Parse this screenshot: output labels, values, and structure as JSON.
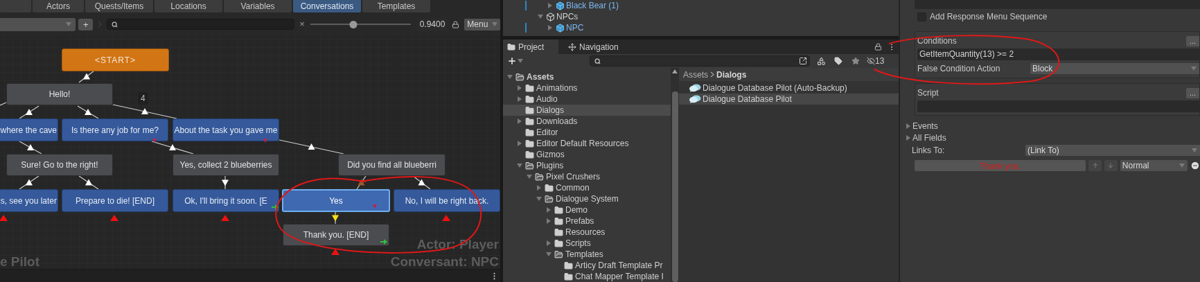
{
  "conversation_editor": {
    "tabs": [
      {
        "label": "Actors",
        "selected": false
      },
      {
        "label": "Quests/Items",
        "selected": false
      },
      {
        "label": "Locations",
        "selected": false
      },
      {
        "label": "Variables",
        "selected": false
      },
      {
        "label": "Conversations",
        "selected": true
      },
      {
        "label": "Templates",
        "selected": false
      }
    ],
    "toolbar": {
      "add_button": "+",
      "clear_search": "×",
      "zoom": {
        "level": 0.43,
        "value": "0.9400"
      },
      "menu_button": "Menu"
    },
    "nodes": [
      {
        "text": "<START>",
        "kind": "start",
        "selected": false
      },
      {
        "text": "Hello!",
        "kind": "npc",
        "selected": false
      },
      {
        "text": "where the cave",
        "kind": "player",
        "selected": false
      },
      {
        "text": "Is there any job for me?",
        "kind": "player",
        "selected": false
      },
      {
        "text": "About the task you gave me",
        "kind": "player",
        "selected": false
      },
      {
        "text": "Sure! Go to the right!",
        "kind": "npc",
        "selected": false
      },
      {
        "text": "Yes, collect 2 blueberries",
        "kind": "npc",
        "selected": false
      },
      {
        "text": "Did you find all blueberri",
        "kind": "npc",
        "selected": false
      },
      {
        "text": "s, see you later",
        "kind": "player",
        "selected": false
      },
      {
        "text": "Prepare to die! [END]",
        "kind": "player",
        "selected": false
      },
      {
        "text": "Ok, I'll bring it soon. [E",
        "kind": "player",
        "selected": false
      },
      {
        "text": "Yes",
        "kind": "player",
        "selected": true
      },
      {
        "text": "No, I will be right back.",
        "kind": "player",
        "selected": false
      },
      {
        "text": "Thank you. [END]",
        "kind": "npc",
        "selected": false
      }
    ],
    "link_count": "4",
    "canvas_labels": {
      "database": "e Pilot",
      "actor": "Actor: Player",
      "conversant": "Conversant: NPC"
    }
  },
  "hierarchy": {
    "cut_parent_children": [
      {
        "name": "Black Bear (1)",
        "kind": "prefab",
        "expanded": false
      }
    ],
    "items": [
      {
        "name": "NPCs",
        "kind": "object",
        "expanded": true,
        "children": [
          {
            "name": "NPC",
            "kind": "prefab",
            "expanded": false
          }
        ]
      }
    ]
  },
  "project": {
    "tabs": [
      {
        "label": "Project",
        "selected": true
      },
      {
        "label": "Navigation",
        "selected": false
      }
    ],
    "hidden_count": "13",
    "tree": [
      {
        "name": "Assets",
        "has_children": true,
        "expanded": true,
        "selected": false,
        "children": [
          {
            "name": "Animations",
            "has_children": true,
            "expanded": false,
            "selected": false
          },
          {
            "name": "Audio",
            "has_children": true,
            "expanded": false,
            "selected": false
          },
          {
            "name": "Dialogs",
            "has_children": false,
            "expanded": false,
            "selected": true
          },
          {
            "name": "Downloads",
            "has_children": true,
            "expanded": false,
            "selected": false
          },
          {
            "name": "Editor",
            "has_children": false,
            "expanded": false,
            "selected": false
          },
          {
            "name": "Editor Default Resources",
            "has_children": true,
            "expanded": false,
            "selected": false
          },
          {
            "name": "Gizmos",
            "has_children": false,
            "expanded": false,
            "selected": false
          },
          {
            "name": "Plugins",
            "has_children": true,
            "expanded": true,
            "selected": false,
            "children": [
              {
                "name": "Pixel Crushers",
                "has_children": true,
                "expanded": true,
                "selected": false,
                "children": [
                  {
                    "name": "Common",
                    "has_children": true,
                    "expanded": false,
                    "selected": false
                  },
                  {
                    "name": "Dialogue System",
                    "has_children": true,
                    "expanded": true,
                    "selected": false,
                    "children": [
                      {
                        "name": "Demo",
                        "has_children": true,
                        "expanded": false,
                        "selected": false
                      },
                      {
                        "name": "Prefabs",
                        "has_children": true,
                        "expanded": false,
                        "selected": false
                      },
                      {
                        "name": "Resources",
                        "has_children": false,
                        "expanded": false,
                        "selected": false
                      },
                      {
                        "name": "Scripts",
                        "has_children": true,
                        "expanded": false,
                        "selected": false
                      },
                      {
                        "name": "Templates",
                        "has_children": true,
                        "expanded": true,
                        "selected": false,
                        "children": [
                          {
                            "name": "Articy Draft Template Pr",
                            "has_children": false,
                            "expanded": false,
                            "selected": false
                          },
                          {
                            "name": "Chat Mapper Template I",
                            "has_children": false,
                            "expanded": false,
                            "selected": false
                          }
                        ]
                      }
                    ]
                  }
                ]
              }
            ]
          }
        ]
      }
    ],
    "breadcrumb": [
      "Assets",
      "Dialogs"
    ],
    "files": [
      {
        "name": "Dialogue Database Pilot (Auto-Backup)",
        "selected": false
      },
      {
        "name": "Dialogue Database Pilot",
        "selected": true
      }
    ]
  },
  "inspector": {
    "add_response_menu_sequence": {
      "label": "Add Response Menu Sequence",
      "checked": false
    },
    "conditions": {
      "label": "Conditions",
      "more_button": "...",
      "value": "GetItemQuantity(13) >= 2",
      "false_action_label": "False Condition Action",
      "false_action": "Block"
    },
    "script": {
      "label": "Script",
      "more_button": "..."
    },
    "sections": [
      {
        "label": "Events",
        "expanded": false
      },
      {
        "label": "All Fields",
        "expanded": false
      }
    ],
    "links_to": {
      "label": "Links To:",
      "value": "(Link To)"
    },
    "links": [
      {
        "target": "Thank you.",
        "priority": "Normal"
      }
    ]
  }
}
